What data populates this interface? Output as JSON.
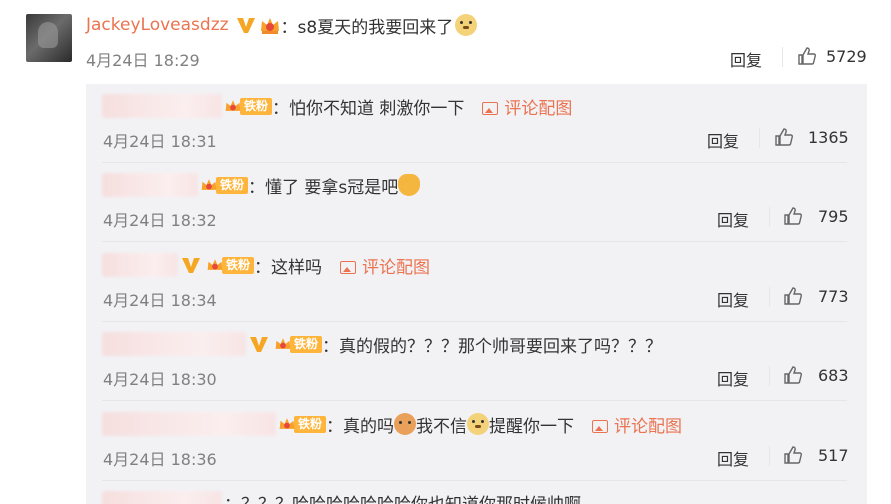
{
  "main_comment": {
    "username": "JackeyLoveasdzz",
    "separator": "：",
    "text": "s8夏天的我要回来了",
    "emoji": "doge-emoji",
    "time": "4月24日 18:29",
    "reply_label": "回复",
    "likes": "5729"
  },
  "replies": [
    {
      "badge_label": "铁粉",
      "separator": "：",
      "text": "怕你不知道 刺激你一下",
      "pic_link": "评论配图",
      "time": "4月24日 18:31",
      "reply_label": "回复",
      "likes": "1365"
    },
    {
      "badge_label": "铁粉",
      "separator": "：",
      "text": "懂了 要拿s冠是吧",
      "emoji": "fist-emoji",
      "time": "4月24日 18:32",
      "reply_label": "回复",
      "likes": "795"
    },
    {
      "badge_label": "铁粉",
      "separator": "：",
      "text": "这样吗",
      "pic_link": "评论配图",
      "time": "4月24日 18:34",
      "reply_label": "回复",
      "likes": "773"
    },
    {
      "badge_label": "铁粉",
      "separator": "：",
      "text": "真的假的？？？那个帅哥要回来了吗？？？",
      "time": "4月24日 18:30",
      "reply_label": "回复",
      "likes": "683"
    },
    {
      "badge_label": "铁粉",
      "separator": "：",
      "text_a": "真的吗",
      "text_b": "我不信",
      "text_c": "提醒你一下",
      "pic_link": "评论配图",
      "time": "4月24日 18:36",
      "reply_label": "回复",
      "likes": "517"
    },
    {
      "separator": "：",
      "text": "？？？哈哈哈哈哈哈哈你也知道你那时候帅啊"
    }
  ],
  "colors": {
    "username": "#eb7350",
    "link": "#eb7350",
    "time": "#808080",
    "panel_bg": "#f2f2f5",
    "fan_badge": "#ffb43b",
    "vip_v": "#f5a623"
  }
}
